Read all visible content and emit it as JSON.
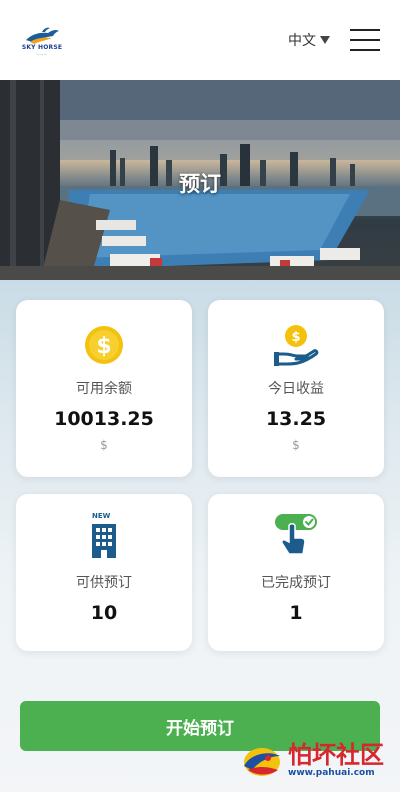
{
  "header": {
    "logo_text": "SKY HORSE",
    "language": "中文"
  },
  "banner": {
    "title": "预订"
  },
  "cards": [
    {
      "label": "可用余额",
      "value": "10013.25",
      "unit": "$",
      "icon": "dollar-coin-icon"
    },
    {
      "label": "今日收益",
      "value": "13.25",
      "unit": "$",
      "icon": "hand-coin-icon"
    },
    {
      "label": "可供预订",
      "value": "10",
      "badge": "NEW",
      "icon": "building-icon"
    },
    {
      "label": "已完成预订",
      "value": "1",
      "icon": "hand-check-icon"
    }
  ],
  "start_button": "开始预订",
  "watermark": {
    "text": "怕坏社区",
    "url": "www.pahuai.com"
  },
  "colors": {
    "primary_green": "#4caf50",
    "coin_yellow": "#f4c20d",
    "icon_blue": "#1c5c8c"
  }
}
